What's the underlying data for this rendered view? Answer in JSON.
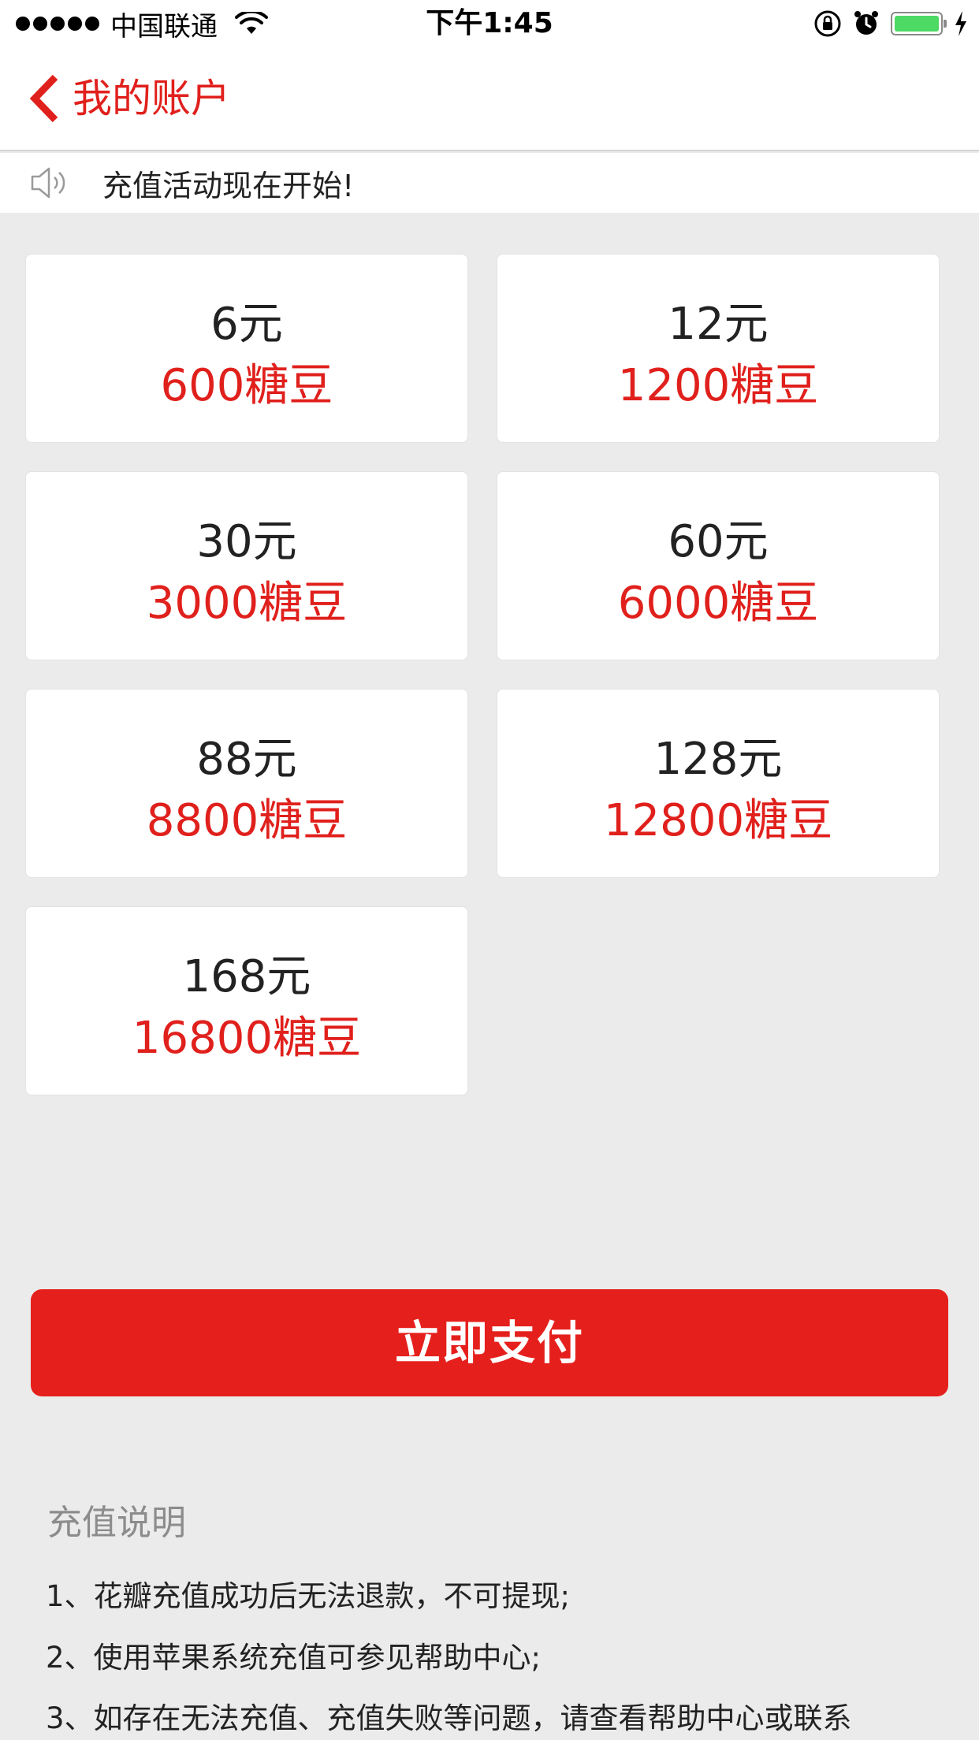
{
  "status_bar": {
    "carrier": "中国联通",
    "time": "下午1:45",
    "battery_level": 1.0,
    "icons": [
      "signal-dots-icon",
      "wifi-icon",
      "orientation-lock-icon",
      "alarm-icon",
      "battery-icon",
      "charging-bolt-icon"
    ]
  },
  "nav": {
    "title": "我的账户",
    "back_icon": "chevron-left-icon"
  },
  "notice": {
    "icon": "speaker-icon",
    "text": "充值活动现在开始!"
  },
  "packages": [
    {
      "price": "6元",
      "beans": "600糖豆"
    },
    {
      "price": "12元",
      "beans": "1200糖豆"
    },
    {
      "price": "30元",
      "beans": "3000糖豆"
    },
    {
      "price": "60元",
      "beans": "6000糖豆"
    },
    {
      "price": "88元",
      "beans": "8800糖豆"
    },
    {
      "price": "128元",
      "beans": "12800糖豆"
    },
    {
      "price": "168元",
      "beans": "16800糖豆"
    }
  ],
  "pay_button": {
    "label": "立即支付"
  },
  "instructions": {
    "title": "充值说明",
    "items": [
      "1、花瓣充值成功后无法退款，不可提现;",
      "2、使用苹果系统充值可参见帮助中心;",
      "3、如存在无法充值、充值失败等问题，请查看帮助中心或联系"
    ]
  },
  "colors": {
    "accent": "#e5201c",
    "background": "#ebebeb",
    "card": "#ffffff",
    "battery": "#4cd964"
  }
}
